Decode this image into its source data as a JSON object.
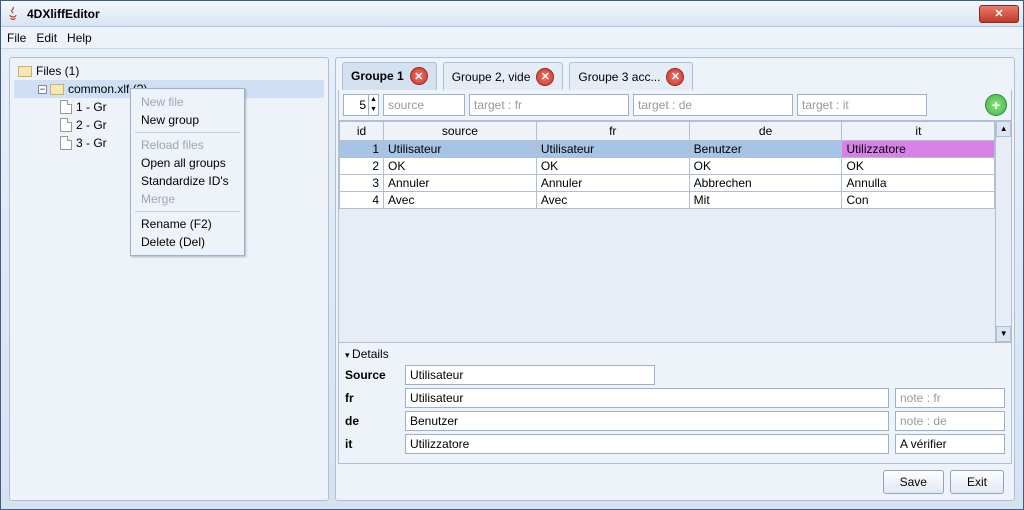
{
  "window": {
    "title": "4DXliffEditor"
  },
  "menu": {
    "file": "File",
    "edit": "Edit",
    "help": "Help"
  },
  "tree": {
    "root": "Files (1)",
    "file": "common.xlf (?)",
    "g1": "1 - Gr",
    "g2": "2 - Gr",
    "g3": "3 - Gr"
  },
  "context_menu": {
    "new_file": "New file",
    "new_group": "New group",
    "reload": "Reload files",
    "open_all": "Open all groups",
    "standardize": "Standardize ID's",
    "merge": "Merge",
    "rename": "Rename (F2)",
    "delete": "Delete (Del)"
  },
  "tabs": {
    "t1": "Groupe 1",
    "t2": "Groupe 2, vide",
    "t3": "Groupe 3 acc..."
  },
  "filter": {
    "spinner": "5",
    "ph_source": "source",
    "ph_fr": "target : fr",
    "ph_de": "target : de",
    "ph_it": "target : it"
  },
  "grid": {
    "h_id": "id",
    "h_source": "source",
    "h_fr": "fr",
    "h_de": "de",
    "h_it": "it",
    "rows": [
      {
        "id": "1",
        "source": "Utilisateur",
        "fr": "Utilisateur",
        "de": "Benutzer",
        "it": "Utilizzatore"
      },
      {
        "id": "2",
        "source": "OK",
        "fr": "OK",
        "de": "OK",
        "it": "OK"
      },
      {
        "id": "3",
        "source": "Annuler",
        "fr": "Annuler",
        "de": "Abbrechen",
        "it": "Annulla"
      },
      {
        "id": "4",
        "source": "Avec",
        "fr": "Avec",
        "de": "Mit",
        "it": "Con"
      }
    ]
  },
  "details": {
    "title": "Details",
    "lbl_source": "Source",
    "lbl_fr": "fr",
    "lbl_de": "de",
    "lbl_it": "it",
    "source": "Utilisateur",
    "fr": "Utilisateur",
    "de": "Benutzer",
    "it": "Utilizzatore",
    "note_fr_ph": "note : fr",
    "note_de_ph": "note : de",
    "note_it": "A vérifier"
  },
  "footer": {
    "save": "Save",
    "exit": "Exit"
  }
}
